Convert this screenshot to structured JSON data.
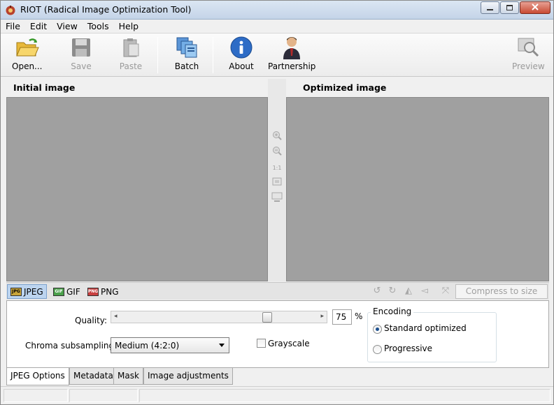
{
  "window": {
    "title": "RIOT (Radical Image Optimization Tool)"
  },
  "menu": [
    "File",
    "Edit",
    "View",
    "Tools",
    "Help"
  ],
  "toolbar": {
    "open": "Open...",
    "save": "Save",
    "paste": "Paste",
    "batch": "Batch",
    "about": "About",
    "partnership": "Partnership",
    "preview": "Preview"
  },
  "panes": {
    "initial": "Initial image",
    "optimized": "Optimized image",
    "zoom_ratio": "1:1"
  },
  "formats": [
    {
      "label": "JPEG",
      "icon_text": "JPG",
      "active": true
    },
    {
      "label": "GIF",
      "icon_text": "GIF",
      "active": false
    },
    {
      "label": "PNG",
      "icon_text": "PNG",
      "active": false
    }
  ],
  "compress_button": "Compress to size",
  "jpeg_options": {
    "quality_label": "Quality:",
    "quality_value": "75",
    "quality_unit": "%",
    "quality_fraction": 0.75,
    "chroma_label": "Chroma subsampling:",
    "chroma_value": "Medium (4:2:0)",
    "grayscale_label": "Grayscale",
    "grayscale_checked": false,
    "encoding_legend": "Encoding",
    "encoding_options": [
      "Standard optimized",
      "Progressive"
    ],
    "encoding_selected": "Standard optimized"
  },
  "tabs": [
    "JPEG Options",
    "Metadata",
    "Mask",
    "Image adjustments"
  ],
  "colors": {
    "pane_bg": "#a0a0a0",
    "active_tab": "#bcd4ef",
    "close_button": "#c84a33"
  }
}
